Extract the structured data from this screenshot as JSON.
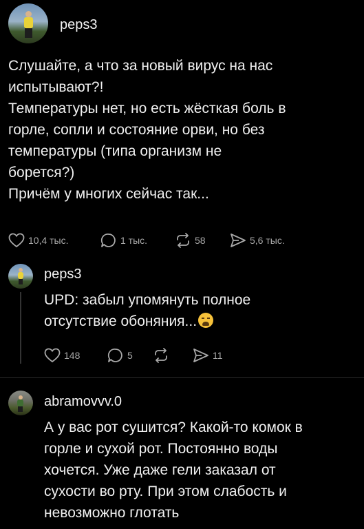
{
  "posts": [
    {
      "username": "peps3",
      "lines": [
        "Слушайте, а что за новый вирус на нас",
        "испытывают?!",
        "Температуры нет, но есть жёсткая боль в",
        "горле, сопли и состояние орви, но без",
        "температуры (типа организм не",
        "борется?)",
        "Причём у многих сейчас так..."
      ],
      "actions": {
        "likes": "10,4 тыс.",
        "replies": "1 тыс.",
        "reposts": "58",
        "shares": "5,6 тыс."
      }
    },
    {
      "username": "peps3",
      "lines": [
        "UPD: забыл упомянуть полное",
        "отсутствие обоняния..."
      ],
      "emoji": "weary-face-emoji",
      "actions": {
        "likes": "148",
        "replies": "5",
        "reposts": "",
        "shares": "11"
      }
    },
    {
      "username": "abramovvv.0",
      "lines": [
        "А у вас рот сушится? Какой-то комок в",
        "горле и сухой рот. Постоянно воды",
        "хочется. Уже даже гели заказал от",
        "сухости во рту. При этом слабость и",
        "невозможно глотать"
      ]
    }
  ],
  "icons": [
    "heart-icon",
    "reply-icon",
    "repost-icon",
    "share-icon"
  ],
  "colors": {
    "background": "#000000",
    "text": "#f0f0f0",
    "muted": "#a9a9a9",
    "divider": "#2c2c2c"
  }
}
